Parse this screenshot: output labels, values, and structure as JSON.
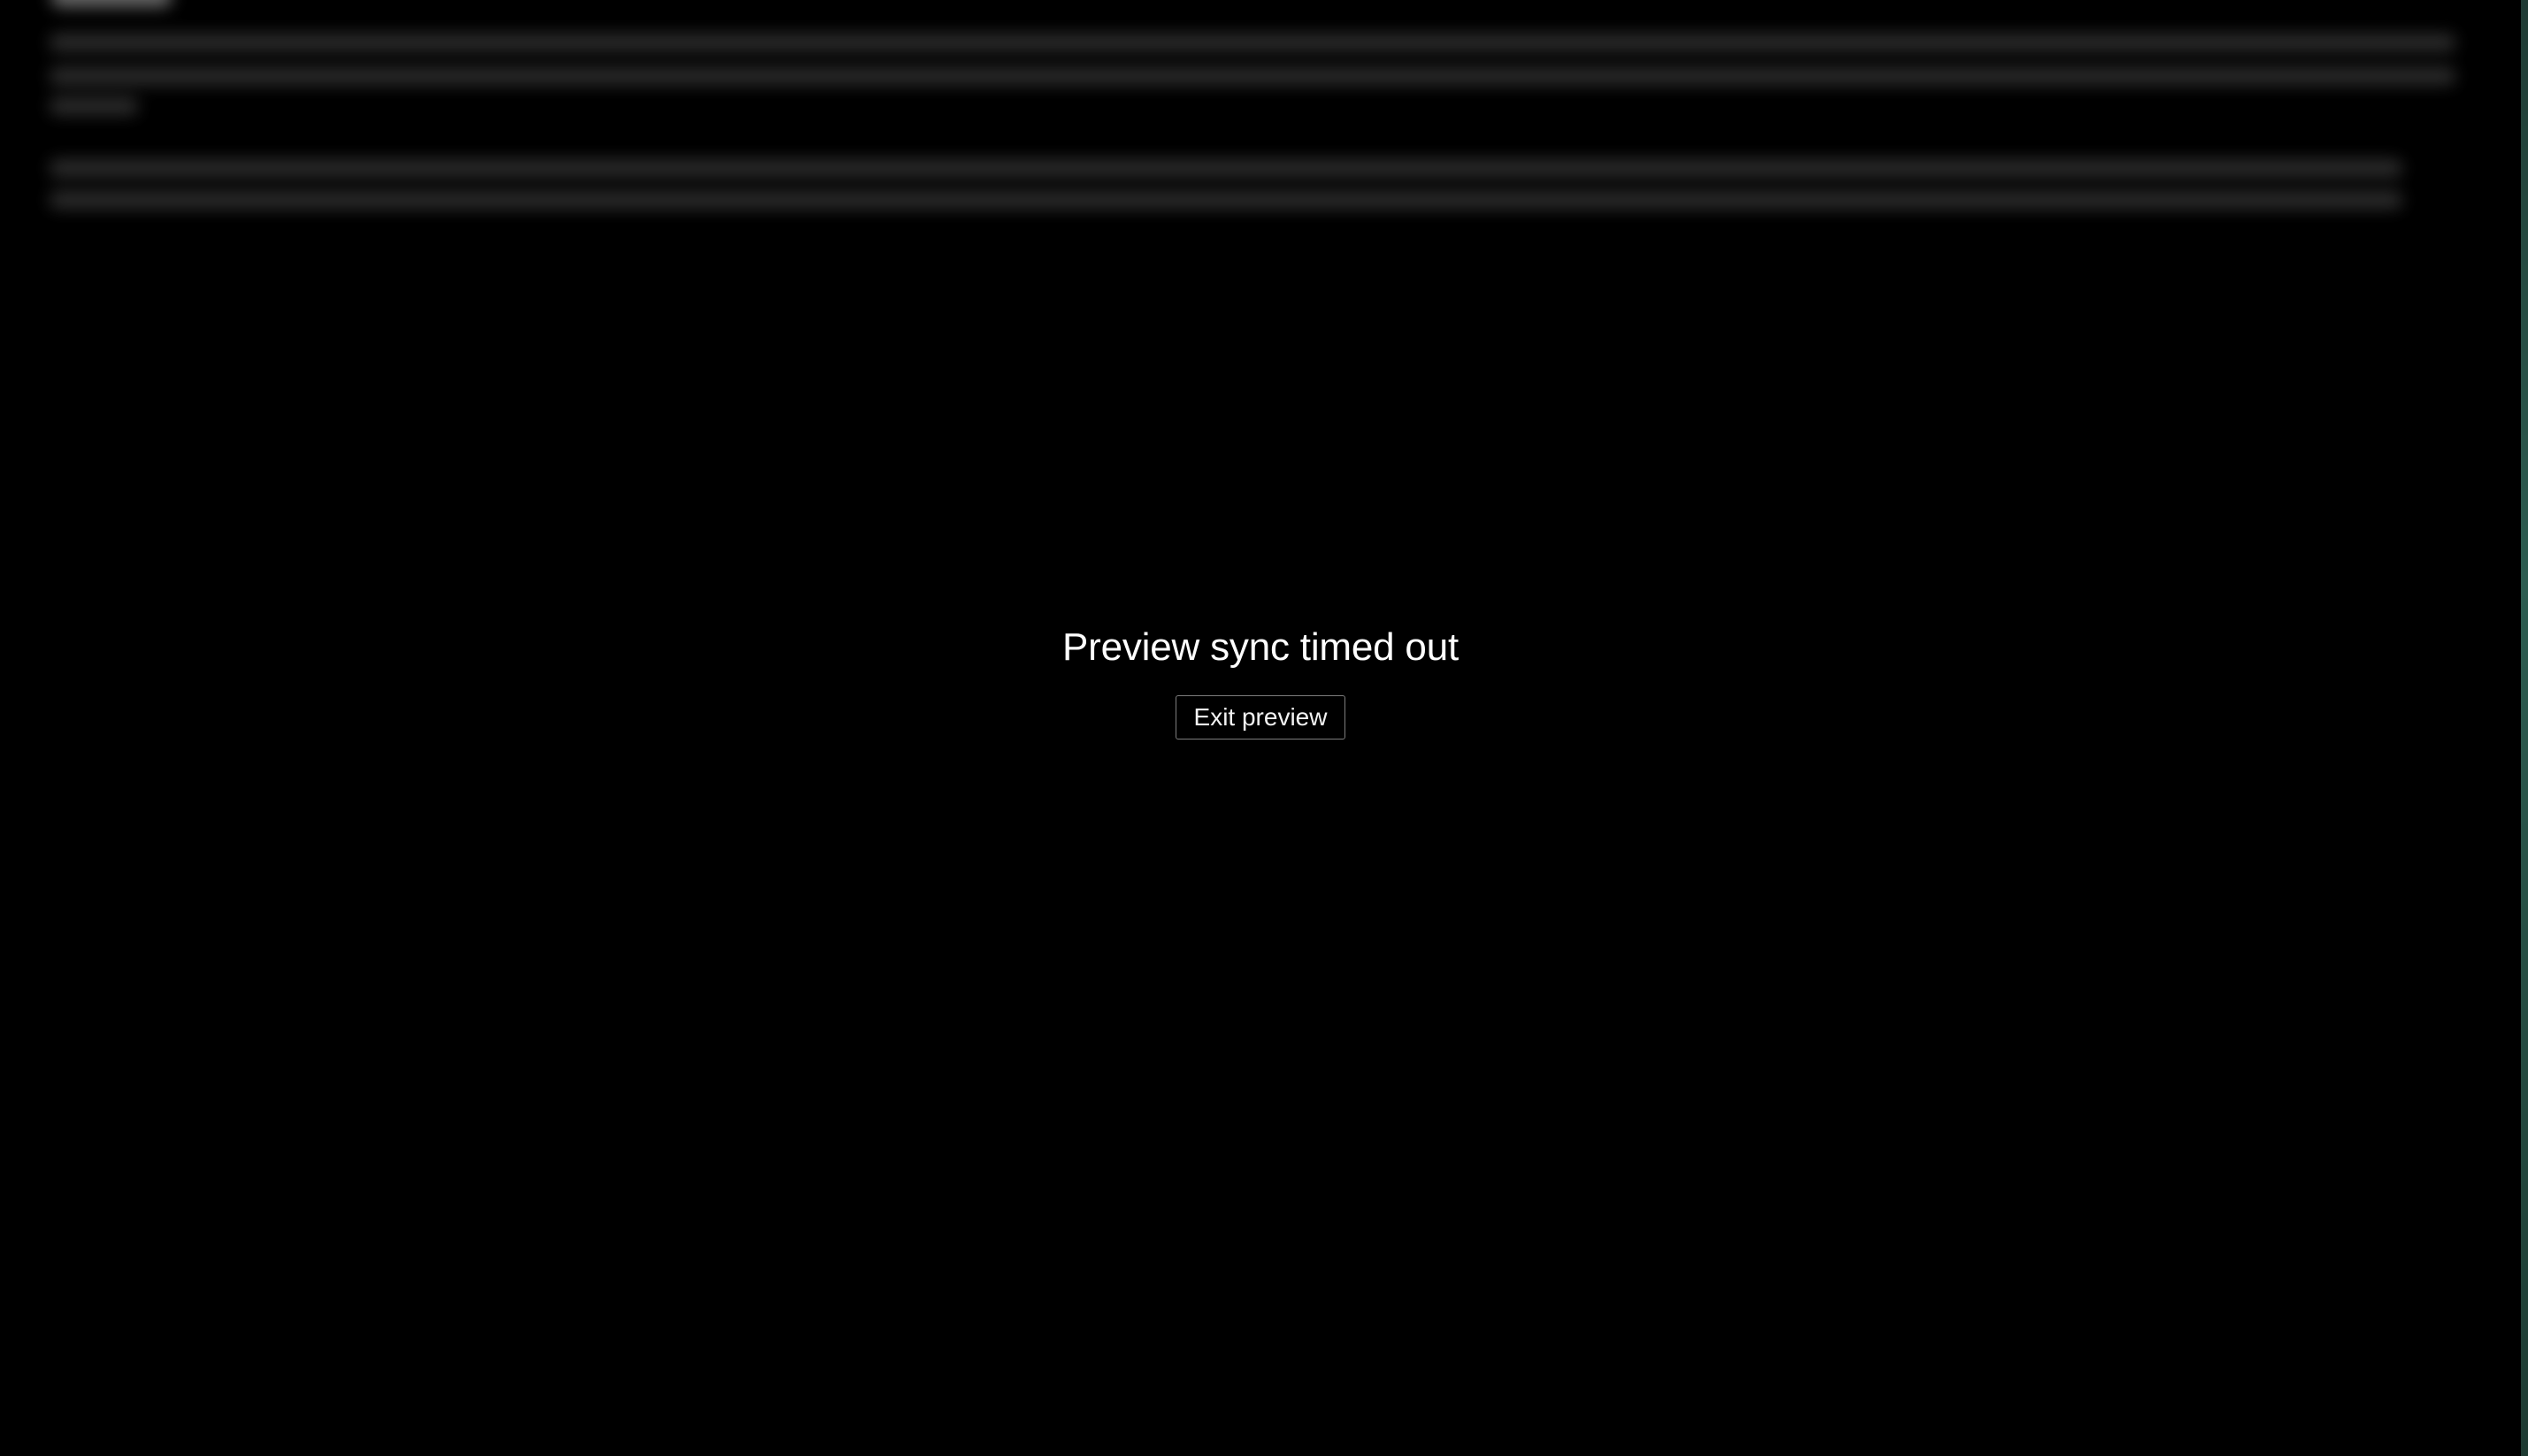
{
  "overlay": {
    "title": "Preview sync timed out",
    "exit_button_label": "Exit preview"
  },
  "colors": {
    "background": "#000000",
    "title_text": "#ffffff",
    "button_border": "#7d7d7d",
    "edge_strip": "#2d5c50"
  }
}
